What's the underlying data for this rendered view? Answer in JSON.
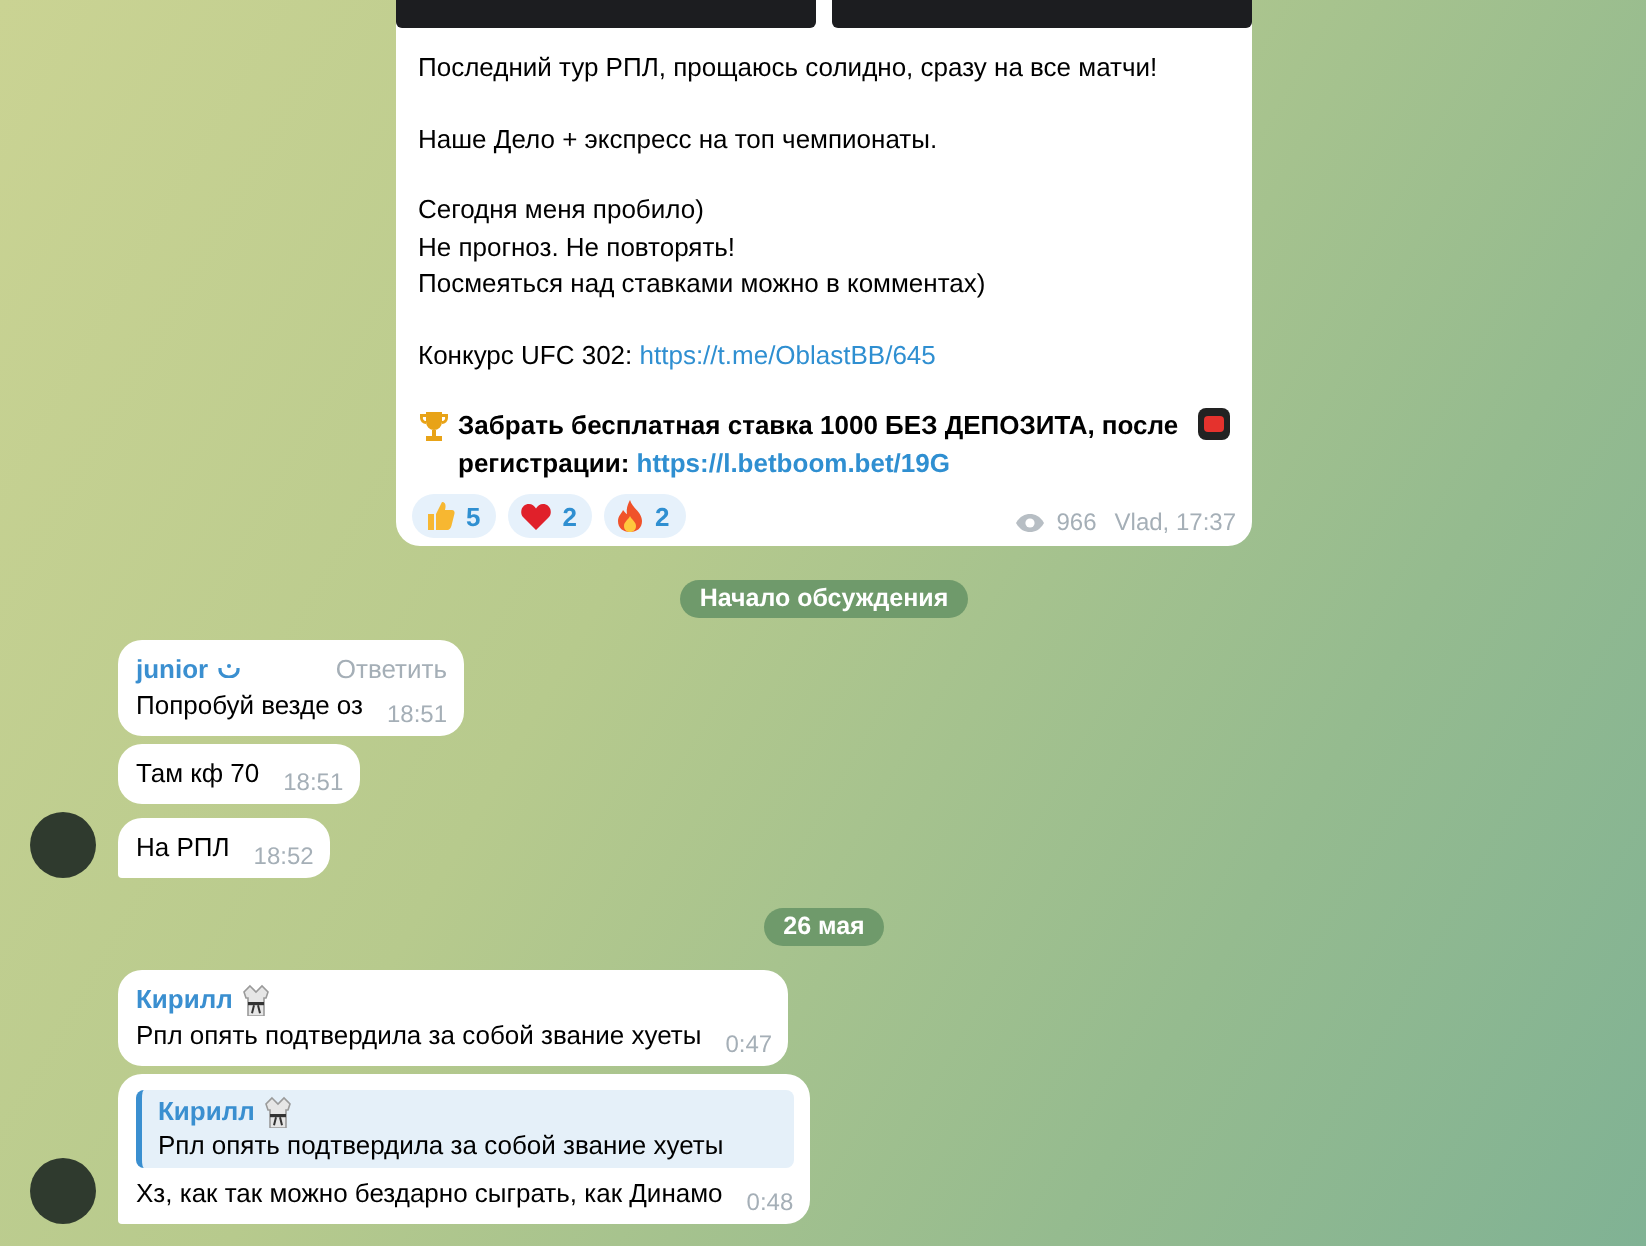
{
  "post": {
    "photos": [
      {
        "kind": "photo"
      },
      {
        "kind": "photo"
      }
    ],
    "paragraphs": [
      {
        "kind": "text",
        "lines": [
          "Последний тур РПЛ, прощаюсь солидно, сразу на все матчи!"
        ]
      },
      {
        "kind": "text",
        "lines": [
          "Наше Дело + экспресс на топ чемпионаты."
        ]
      },
      {
        "kind": "text",
        "lines": [
          "Сегодня меня пробило)",
          "Не прогноз. Не повторять!",
          "Посмеяться над ставками можно в комментах)"
        ]
      },
      {
        "kind": "link",
        "text": "Конкурс UFC 302:",
        "link": "https://t.me/OblastBB/645"
      },
      {
        "kind": "promo",
        "text": "Забрать бесплатная ставка 1000 БЕЗ ДЕПОЗИТА, после регистрации:",
        "link": "https://l.betboom.bet/19G"
      }
    ],
    "reactions": [
      {
        "kind": "thumbs",
        "count": "5"
      },
      {
        "kind": "heart",
        "count": "2"
      },
      {
        "kind": "fire",
        "count": "2"
      }
    ],
    "views": "966",
    "signature": "Vlad, 17:37"
  },
  "service": "Начало обсуждения",
  "comments": [
    {
      "kind": "message",
      "author": "junior",
      "badge": {
        "kind": "arc"
      },
      "action": "Ответить",
      "text": "Попробуй везде оз",
      "time": "18:51",
      "avatar": false
    },
    {
      "kind": "message",
      "text": "Там кф 70",
      "time": "18:51",
      "avatar": false
    },
    {
      "kind": "message",
      "text": "На РПЛ",
      "time": "18:52",
      "avatar": true
    },
    {
      "kind": "date",
      "text": "26 мая"
    },
    {
      "kind": "message",
      "author": "Кирилл",
      "badge": {
        "kind": "kimono"
      },
      "text": "Рпл опять подтвердила за собой звание хуеты",
      "time": "0:47",
      "avatar": false
    },
    {
      "kind": "message",
      "reply": {
        "author": "Кирилл",
        "badge": {
          "kind": "kimono"
        },
        "text": "Рпл опять подтвердила за собой звание хуеты"
      },
      "text": "Хз, как так можно бездарно сыграть, как Динамо",
      "time": "0:48",
      "avatar": true
    }
  ]
}
